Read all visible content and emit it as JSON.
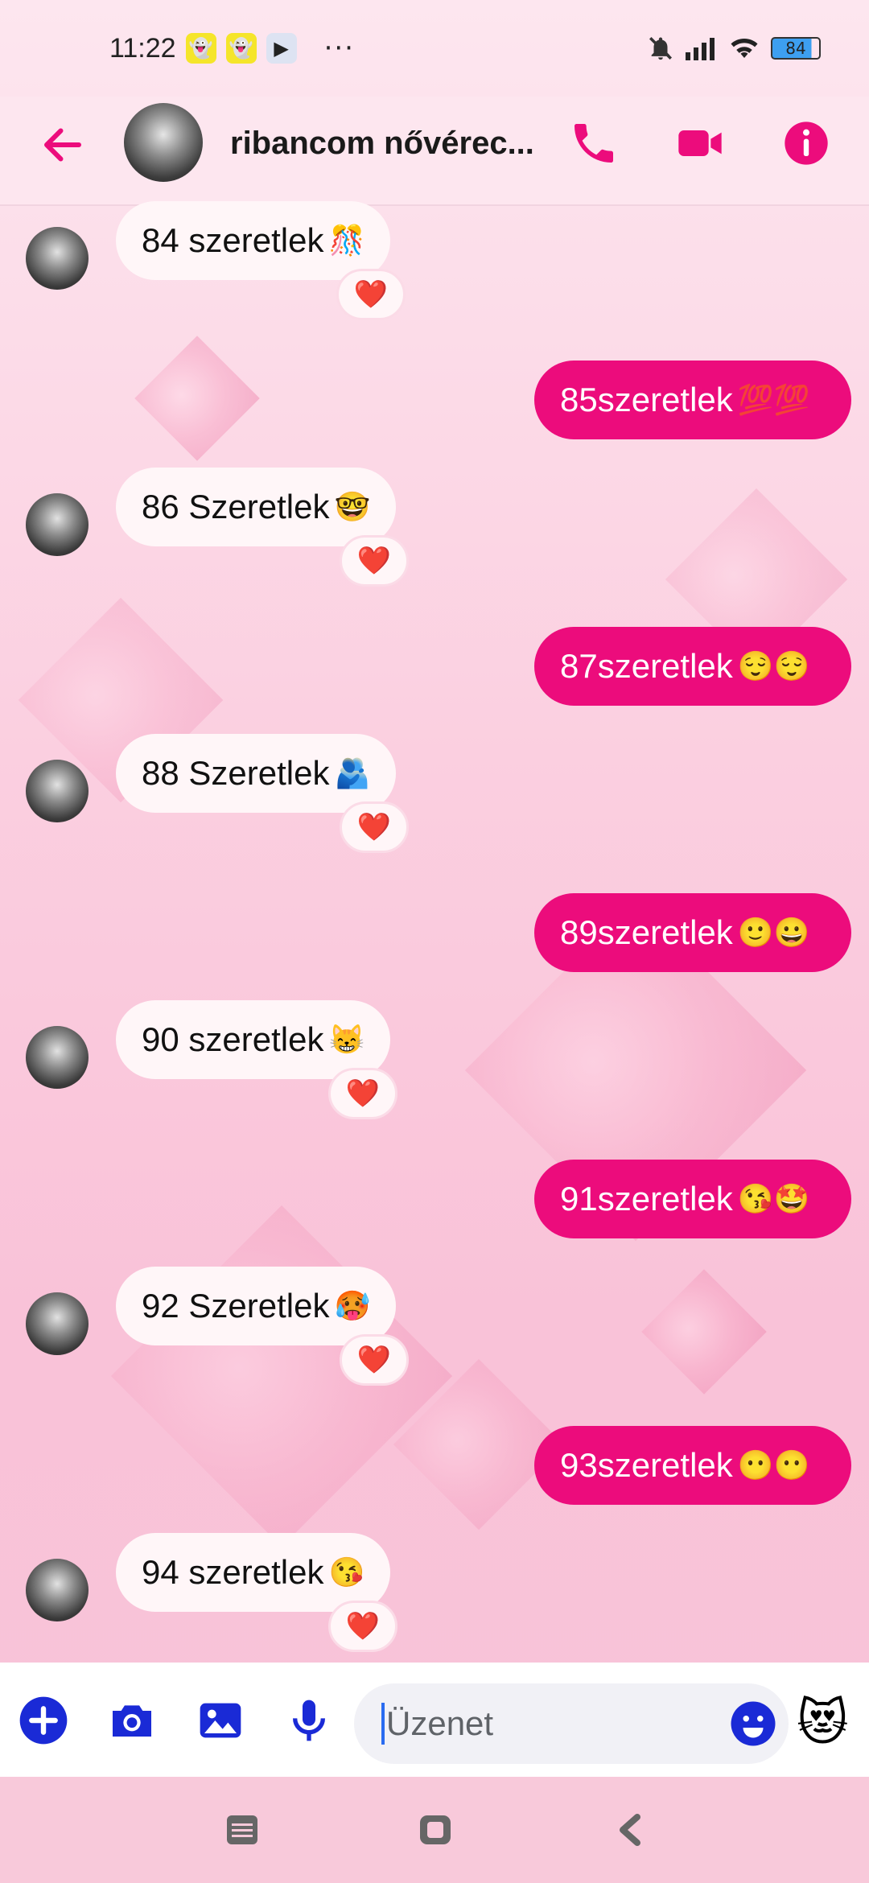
{
  "status_bar": {
    "time": "11:22",
    "battery": "84",
    "more": "···"
  },
  "header": {
    "contact_name": "ribancom nővérec..."
  },
  "messages": [
    {
      "dir": "in",
      "text": "84 szeretlek",
      "emoji": "🎊",
      "reaction": "❤️"
    },
    {
      "dir": "out",
      "text": "85szeretlek",
      "emoji": "💯💯"
    },
    {
      "dir": "in",
      "text": "86 Szeretlek",
      "emoji": "🤓",
      "reaction": "❤️"
    },
    {
      "dir": "out",
      "text": "87szeretlek",
      "emoji": "😌😌"
    },
    {
      "dir": "in",
      "text": "88 Szeretlek",
      "emoji": "🫂",
      "reaction": "❤️"
    },
    {
      "dir": "out",
      "text": "89szeretlek",
      "emoji": "🙂😀"
    },
    {
      "dir": "in",
      "text": "90 szeretlek",
      "emoji": "😸",
      "reaction": "❤️"
    },
    {
      "dir": "out",
      "text": "91szeretlek",
      "emoji": "😘🤩"
    },
    {
      "dir": "in",
      "text": "92 Szeretlek",
      "emoji": "🥵",
      "reaction": "❤️"
    },
    {
      "dir": "out",
      "text": "93szeretlek",
      "emoji": "😶😶"
    },
    {
      "dir": "in",
      "text": "94 szeretlek",
      "emoji": "😘",
      "reaction": "❤️"
    }
  ],
  "composer": {
    "placeholder": "Üzenet",
    "sticker": "😻"
  },
  "colors": {
    "accent": "#ec0c7c",
    "composer_blue": "#1a2ad6"
  }
}
